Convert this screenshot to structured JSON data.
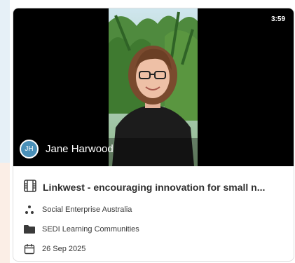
{
  "video": {
    "duration": "3:59",
    "author_initials": "JH",
    "author_name": "Jane Harwood"
  },
  "card": {
    "title": "Linkwest - encouraging innovation for small n...",
    "organisation": "Social Enterprise Australia",
    "folder": "SEDI Learning Communities",
    "date": "26 Sep 2025"
  },
  "colors": {
    "avatar_bg": "#4a90b8",
    "text_dark": "#2e2e2e",
    "icon_color": "#3a3a3a"
  },
  "icons": {
    "title": "video-frames-icon",
    "organisation": "network-dots-icon",
    "folder": "folder-icon",
    "date": "calendar-icon"
  }
}
